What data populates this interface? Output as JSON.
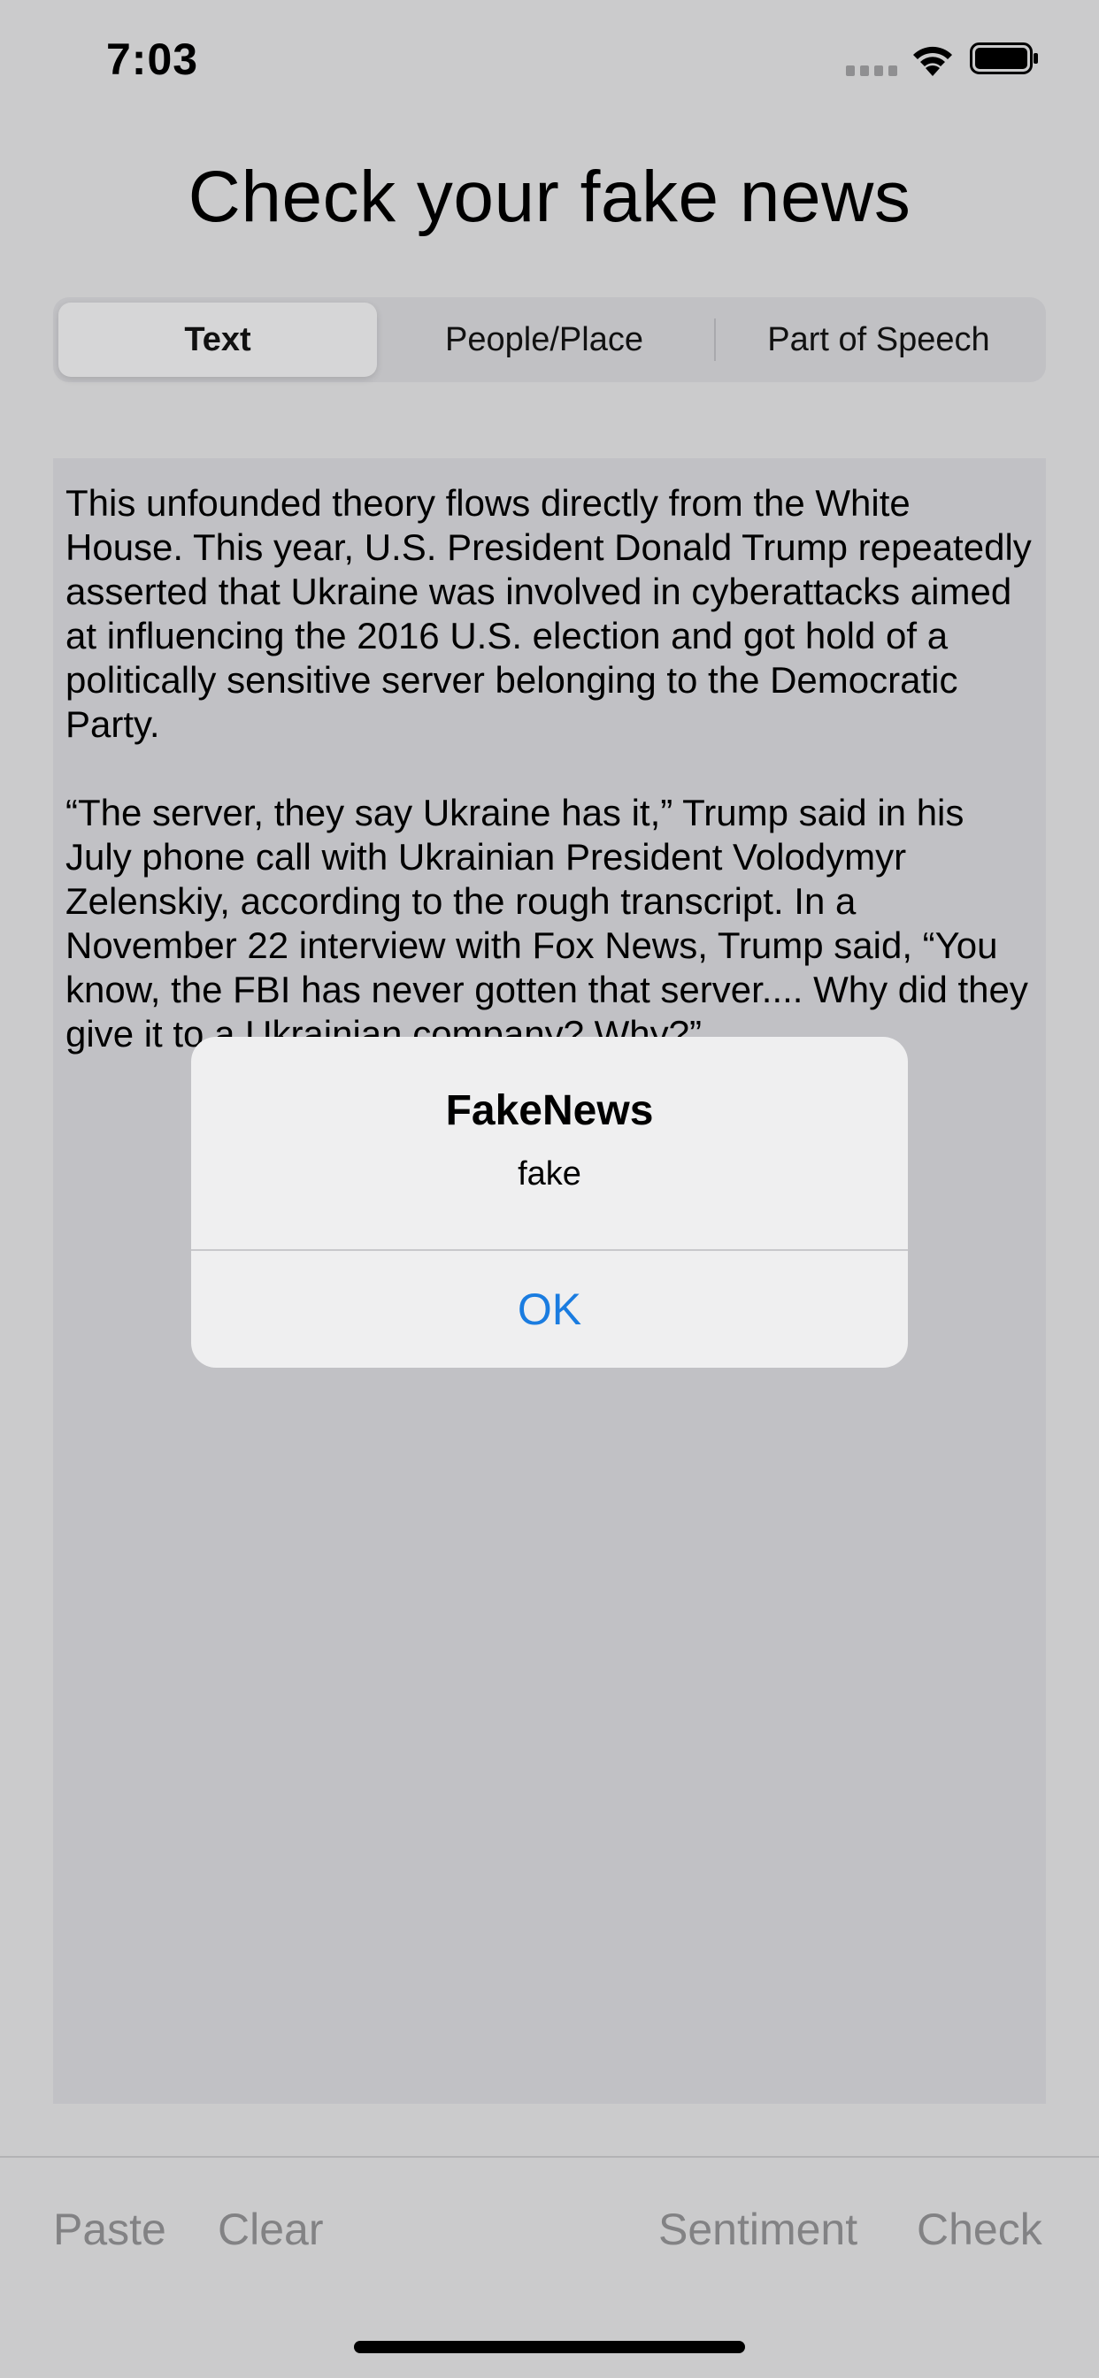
{
  "status_bar": {
    "time": "7:03"
  },
  "header": {
    "title": "Check your fake news"
  },
  "tabs": [
    {
      "label": "Text",
      "selected": true
    },
    {
      "label": "People/Place",
      "selected": false
    },
    {
      "label": "Part of Speech",
      "selected": false
    }
  ],
  "article": {
    "paragraphs": [
      "This unfounded theory flows directly from the White House. This year, U.S. President Donald Trump repeatedly asserted that Ukraine was involved in cyberattacks aimed at influencing the 2016 U.S. election and got hold of a politically sensitive server belonging to the Democratic Party.",
      "“The server, they say Ukraine has it,” Trump said in his July phone call with Ukrainian President Volodymyr Zelenskiy, according to the rough transcript. In a November 22 interview with Fox News, Trump said, “You know, the FBI has never gotten that server.... Why did they give it to a Ukrainian company? Why?”"
    ]
  },
  "alert": {
    "title": "FakeNews",
    "message": "fake",
    "ok_label": "OK"
  },
  "toolbar": {
    "paste_label": "Paste",
    "clear_label": "Clear",
    "sentiment_label": "Sentiment",
    "check_label": "Check"
  },
  "colors": {
    "background": "#cbcbcc",
    "text_area": "#c1c1c5",
    "alert_background": "#efeff0",
    "accent": "#1a7ce0",
    "toolbar_text": "#828284"
  },
  "icons": [
    "cellular-signal-icon",
    "wifi-icon",
    "battery-icon"
  ]
}
